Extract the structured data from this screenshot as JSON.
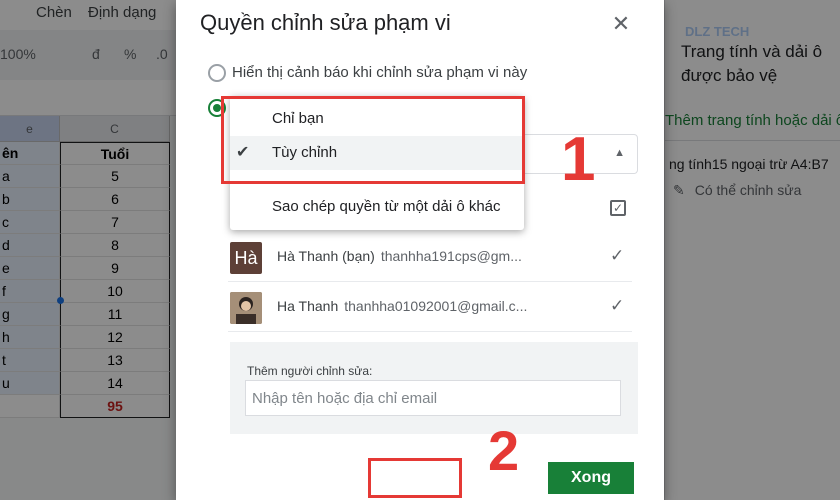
{
  "spreadsheet": {
    "menu": [
      "Chèn",
      "Định dạng"
    ],
    "toolbar": [
      "100%",
      "đ",
      "%",
      ".0"
    ],
    "col_c_header": "C",
    "header_row": {
      "left": "ên",
      "right": "Tuổi"
    },
    "rows": [
      {
        "left": "a",
        "right": "5"
      },
      {
        "left": "b",
        "right": "6"
      },
      {
        "left": "c",
        "right": "7"
      },
      {
        "left": "d",
        "right": "8"
      },
      {
        "left": "e",
        "right": "9"
      },
      {
        "left": "f",
        "right": "10"
      },
      {
        "left": "g",
        "right": "11"
      },
      {
        "left": "h",
        "right": "12"
      },
      {
        "left": "t",
        "right": "13"
      },
      {
        "left": "u",
        "right": "14"
      }
    ],
    "total": "95",
    "col_b_letter": "e"
  },
  "side_panel": {
    "title": "Trang tính và dải ô được bảo vệ",
    "add_link": "Thêm trang tính hoặc dải ô",
    "range_name": "ng tính15 ngoại trừ A4:B7",
    "range_permission": "Có thể chỉnh sửa",
    "logo_text": "DLZ TECH"
  },
  "dialog": {
    "title": "Quyền chỉnh sửa phạm vi",
    "close_label": "✕",
    "option_warn": "Hiển thị cảnh báo khi chỉnh sửa phạm vi này",
    "dropdown": {
      "items": [
        {
          "label": "Chỉ bạn",
          "selected": false
        },
        {
          "label": "Tùy chỉnh",
          "selected": true
        },
        {
          "label": "Sao chép quyền từ một dải ô khác",
          "selected": false
        }
      ]
    },
    "editors": [
      {
        "avatar_text": "Hà",
        "name": "Hà Thanh (bạn)",
        "email": "thanhha191cps@gm...",
        "checked": true
      },
      {
        "avatar_text": "",
        "name": "Ha Thanh",
        "email": "thanhha01092001@gmail.c...",
        "checked": true
      }
    ],
    "add_editor_label": "Thêm người chỉnh sửa:",
    "add_editor_placeholder": "Nhập tên hoặc địa chỉ email",
    "done_label": "Xong"
  },
  "annotations": {
    "step1": "1",
    "step2": "2"
  },
  "colors": {
    "accent_green": "#188038",
    "highlight_red": "#e53935"
  }
}
